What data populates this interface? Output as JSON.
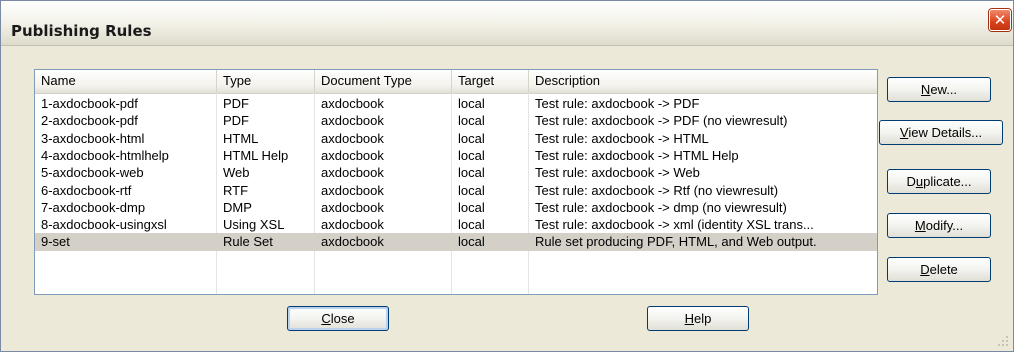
{
  "window": {
    "title": "Publishing Rules",
    "close_glyph": "✕"
  },
  "columns": [
    "Name",
    "Type",
    "Document Type",
    "Target",
    "Description"
  ],
  "rows": [
    [
      "1-axdocbook-pdf",
      "PDF",
      "axdocbook",
      "local",
      "Test rule:  axdocbook -> PDF"
    ],
    [
      "2-axdocbook-pdf",
      "PDF",
      "axdocbook",
      "local",
      "Test rule:  axdocbook -> PDF (no viewresult)"
    ],
    [
      "3-axdocbook-html",
      "HTML",
      "axdocbook",
      "local",
      "Test rule:  axdocbook -> HTML"
    ],
    [
      "4-axdocbook-htmlhelp",
      "HTML Help",
      "axdocbook",
      "local",
      "Test rule:  axdocbook -> HTML Help"
    ],
    [
      "5-axdocbook-web",
      "Web",
      "axdocbook",
      "local",
      "Test rule:  axdocbook -> Web"
    ],
    [
      "6-axdocbook-rtf",
      "RTF",
      "axdocbook",
      "local",
      "Test rule:  axdocbook -> Rtf (no viewresult)"
    ],
    [
      "7-axdocbook-dmp",
      "DMP",
      "axdocbook",
      "local",
      "Test rule:  axdocbook -> dmp (no viewresult)"
    ],
    [
      "8-axdocbook-usingxsl",
      "Using XSL",
      "axdocbook",
      "local",
      "Test rule:  axdocbook -> xml (identity XSL trans..."
    ],
    [
      "9-set",
      "Rule Set",
      "axdocbook",
      "local",
      "Rule set producing PDF, HTML, and Web output."
    ]
  ],
  "selected_row": 8,
  "buttons": {
    "new": {
      "mnemonic": "N",
      "rest": "ew..."
    },
    "view_details": {
      "mnemonic": "V",
      "rest": "iew Details..."
    },
    "duplicate": {
      "pre": "D",
      "mnemonic": "u",
      "rest": "plicate..."
    },
    "modify": {
      "mnemonic": "M",
      "rest": "odify..."
    },
    "delete": {
      "mnemonic": "D",
      "rest": "elete"
    },
    "close": {
      "mnemonic": "C",
      "rest": "lose"
    },
    "help": {
      "mnemonic": "H",
      "rest": "elp"
    }
  }
}
